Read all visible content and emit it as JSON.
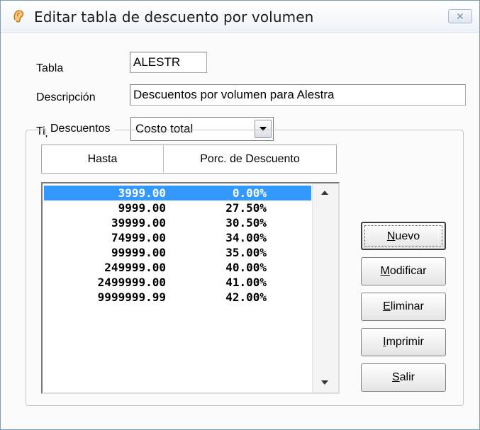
{
  "window": {
    "title": "Editar tabla de descuento por volumen",
    "close_glyph": "✕",
    "title_icon": "ear-icon"
  },
  "form": {
    "tabla_label": "Tabla",
    "tabla_value": "ALESTR",
    "descripcion_label": "Descripción",
    "descripcion_value": "Descuentos por volumen para Alestra",
    "tipo_label": "Tipo",
    "tipo_value": "Costo total"
  },
  "descuentos": {
    "group_label": "Descuentos",
    "columns": [
      "Hasta",
      "Porc. de Descuento"
    ],
    "rows": [
      {
        "hasta": "3999.00",
        "porc": "0.00%"
      },
      {
        "hasta": "9999.00",
        "porc": "27.50%"
      },
      {
        "hasta": "39999.00",
        "porc": "30.50%"
      },
      {
        "hasta": "74999.00",
        "porc": "34.00%"
      },
      {
        "hasta": "99999.00",
        "porc": "35.00%"
      },
      {
        "hasta": "249999.00",
        "porc": "40.00%"
      },
      {
        "hasta": "2499999.00",
        "porc": "41.00%"
      },
      {
        "hasta": "9999999.99",
        "porc": "42.00%"
      }
    ],
    "selected_index": 0
  },
  "buttons": [
    {
      "first": "N",
      "rest": "uevo"
    },
    {
      "first": "M",
      "rest": "odificar"
    },
    {
      "first": "E",
      "rest": "liminar"
    },
    {
      "first": "I",
      "rest": "mprimir"
    },
    {
      "first": "S",
      "rest": "alir"
    }
  ],
  "colors": {
    "selection": "#3399ff",
    "window_border": "#7f9db9"
  }
}
